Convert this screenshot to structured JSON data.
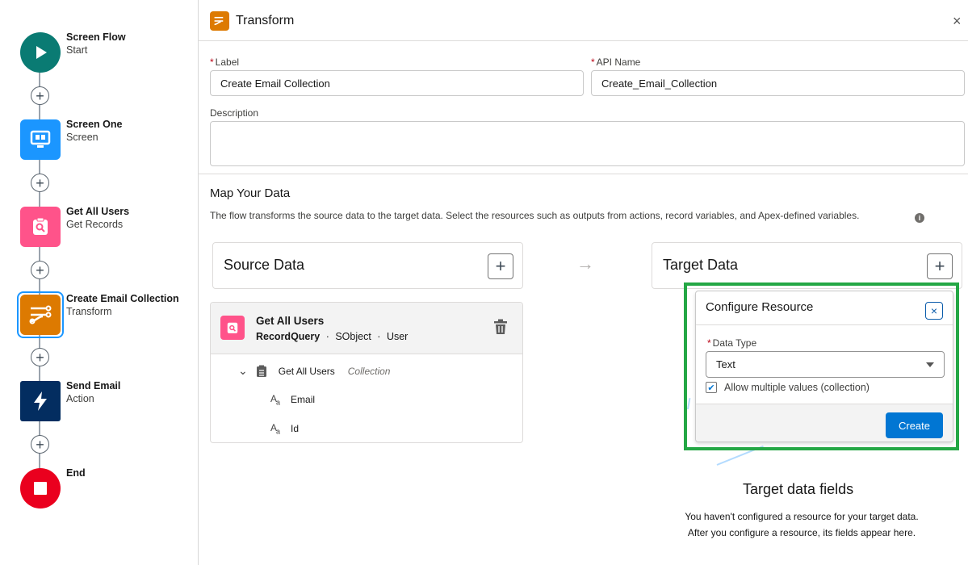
{
  "flow": {
    "nodes": [
      {
        "title": "Screen Flow",
        "subtitle": "Start",
        "color": "#0a7b73",
        "icon": "play-icon"
      },
      {
        "title": "Screen One",
        "subtitle": "Screen",
        "color": "#1b96ff",
        "icon": "screen-icon"
      },
      {
        "title": "Get All Users",
        "subtitle": "Get Records",
        "color": "#ff538a",
        "icon": "record-search-icon"
      },
      {
        "title": "Create Email Collection",
        "subtitle": "Transform",
        "color": "#dd7a01",
        "icon": "transform-icon"
      },
      {
        "title": "Send Email",
        "subtitle": "Action",
        "color": "#032d60",
        "icon": "lightning-icon"
      },
      {
        "title": "End",
        "subtitle": "",
        "color": "#ea001e",
        "icon": "stop-icon"
      }
    ],
    "add_symbol": "+"
  },
  "panel": {
    "title": "Transform",
    "close": "×",
    "label_field": {
      "label": "Label",
      "required": "*",
      "value": "Create Email Collection"
    },
    "api_field": {
      "label": "API Name",
      "required": "*",
      "value": "Create_Email_Collection"
    },
    "description_field": {
      "label": "Description",
      "value": ""
    },
    "map": {
      "title": "Map Your Data",
      "description": "The flow transforms the source data to the target data. Select the resources such as outputs from actions, record variables, and Apex-defined variables.",
      "info": "i"
    },
    "source": {
      "title": "Source Data",
      "add": "+",
      "item": {
        "name": "Get All Users",
        "type": "RecordQuery",
        "kind": "SObject",
        "object": "User",
        "dot": "·"
      },
      "tree": {
        "chevron": "⌄",
        "root": "Get All Users",
        "root_type": "Collection",
        "fields": [
          "Email",
          "Id"
        ],
        "field_icon": "A"
      }
    },
    "arrow": "→",
    "target": {
      "title": "Target Data",
      "add": "+",
      "empty_title": "Target data fields",
      "empty_line1": "You haven't configured a resource for your target data.",
      "empty_line2": "After you configure a resource, its fields appear here."
    }
  },
  "popup": {
    "title": "Configure Resource",
    "close": "×",
    "data_type": {
      "label": "Data Type",
      "required": "*",
      "value": "Text"
    },
    "multiple": {
      "label": "Allow multiple values (collection)",
      "checked": "✔"
    },
    "create": "Create"
  },
  "colors": {
    "highlight": "#24a745",
    "brand": "#0176d3"
  }
}
